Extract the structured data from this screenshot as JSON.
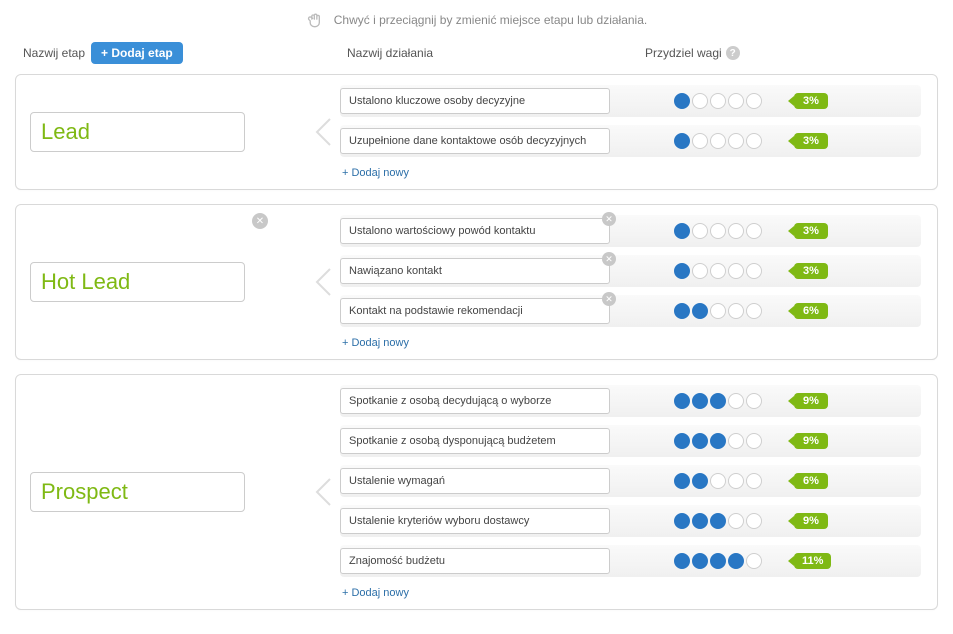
{
  "hint": "Chwyć i przeciągnij by zmienić miejsce etapu lub działania.",
  "headers": {
    "stage": "Nazwij etap",
    "add_stage": "+ Dodaj etap",
    "actions": "Nazwij działania",
    "weights": "Przydziel wagi"
  },
  "add_new_label": "+ Dodaj nowy",
  "stages": [
    {
      "name": "Lead",
      "show_delete": false,
      "actions": [
        {
          "label": "Ustalono kluczowe osoby decyzyjne",
          "dots": 1,
          "weight": "3%",
          "show_delete": false
        },
        {
          "label": "Uzupełnione dane kontaktowe osób decyzyjnych",
          "dots": 1,
          "weight": "3%",
          "show_delete": false
        }
      ]
    },
    {
      "name": "Hot Lead",
      "show_delete": true,
      "actions": [
        {
          "label": "Ustalono wartościowy powód kontaktu",
          "dots": 1,
          "weight": "3%",
          "show_delete": true
        },
        {
          "label": "Nawiązano kontakt",
          "dots": 1,
          "weight": "3%",
          "show_delete": true
        },
        {
          "label": "Kontakt na podstawie rekomendacji",
          "dots": 2,
          "weight": "6%",
          "show_delete": true
        }
      ]
    },
    {
      "name": "Prospect",
      "show_delete": false,
      "actions": [
        {
          "label": "Spotkanie z osobą decydującą o wyborze",
          "dots": 3,
          "weight": "9%",
          "show_delete": false
        },
        {
          "label": "Spotkanie z osobą dysponującą budżetem",
          "dots": 3,
          "weight": "9%",
          "show_delete": false
        },
        {
          "label": "Ustalenie wymagań",
          "dots": 2,
          "weight": "6%",
          "show_delete": false
        },
        {
          "label": "Ustalenie kryteriów wyboru dostawcy",
          "dots": 3,
          "weight": "9%",
          "show_delete": false
        },
        {
          "label": "Znajomość budżetu",
          "dots": 4,
          "weight": "11%",
          "show_delete": false
        }
      ]
    }
  ]
}
